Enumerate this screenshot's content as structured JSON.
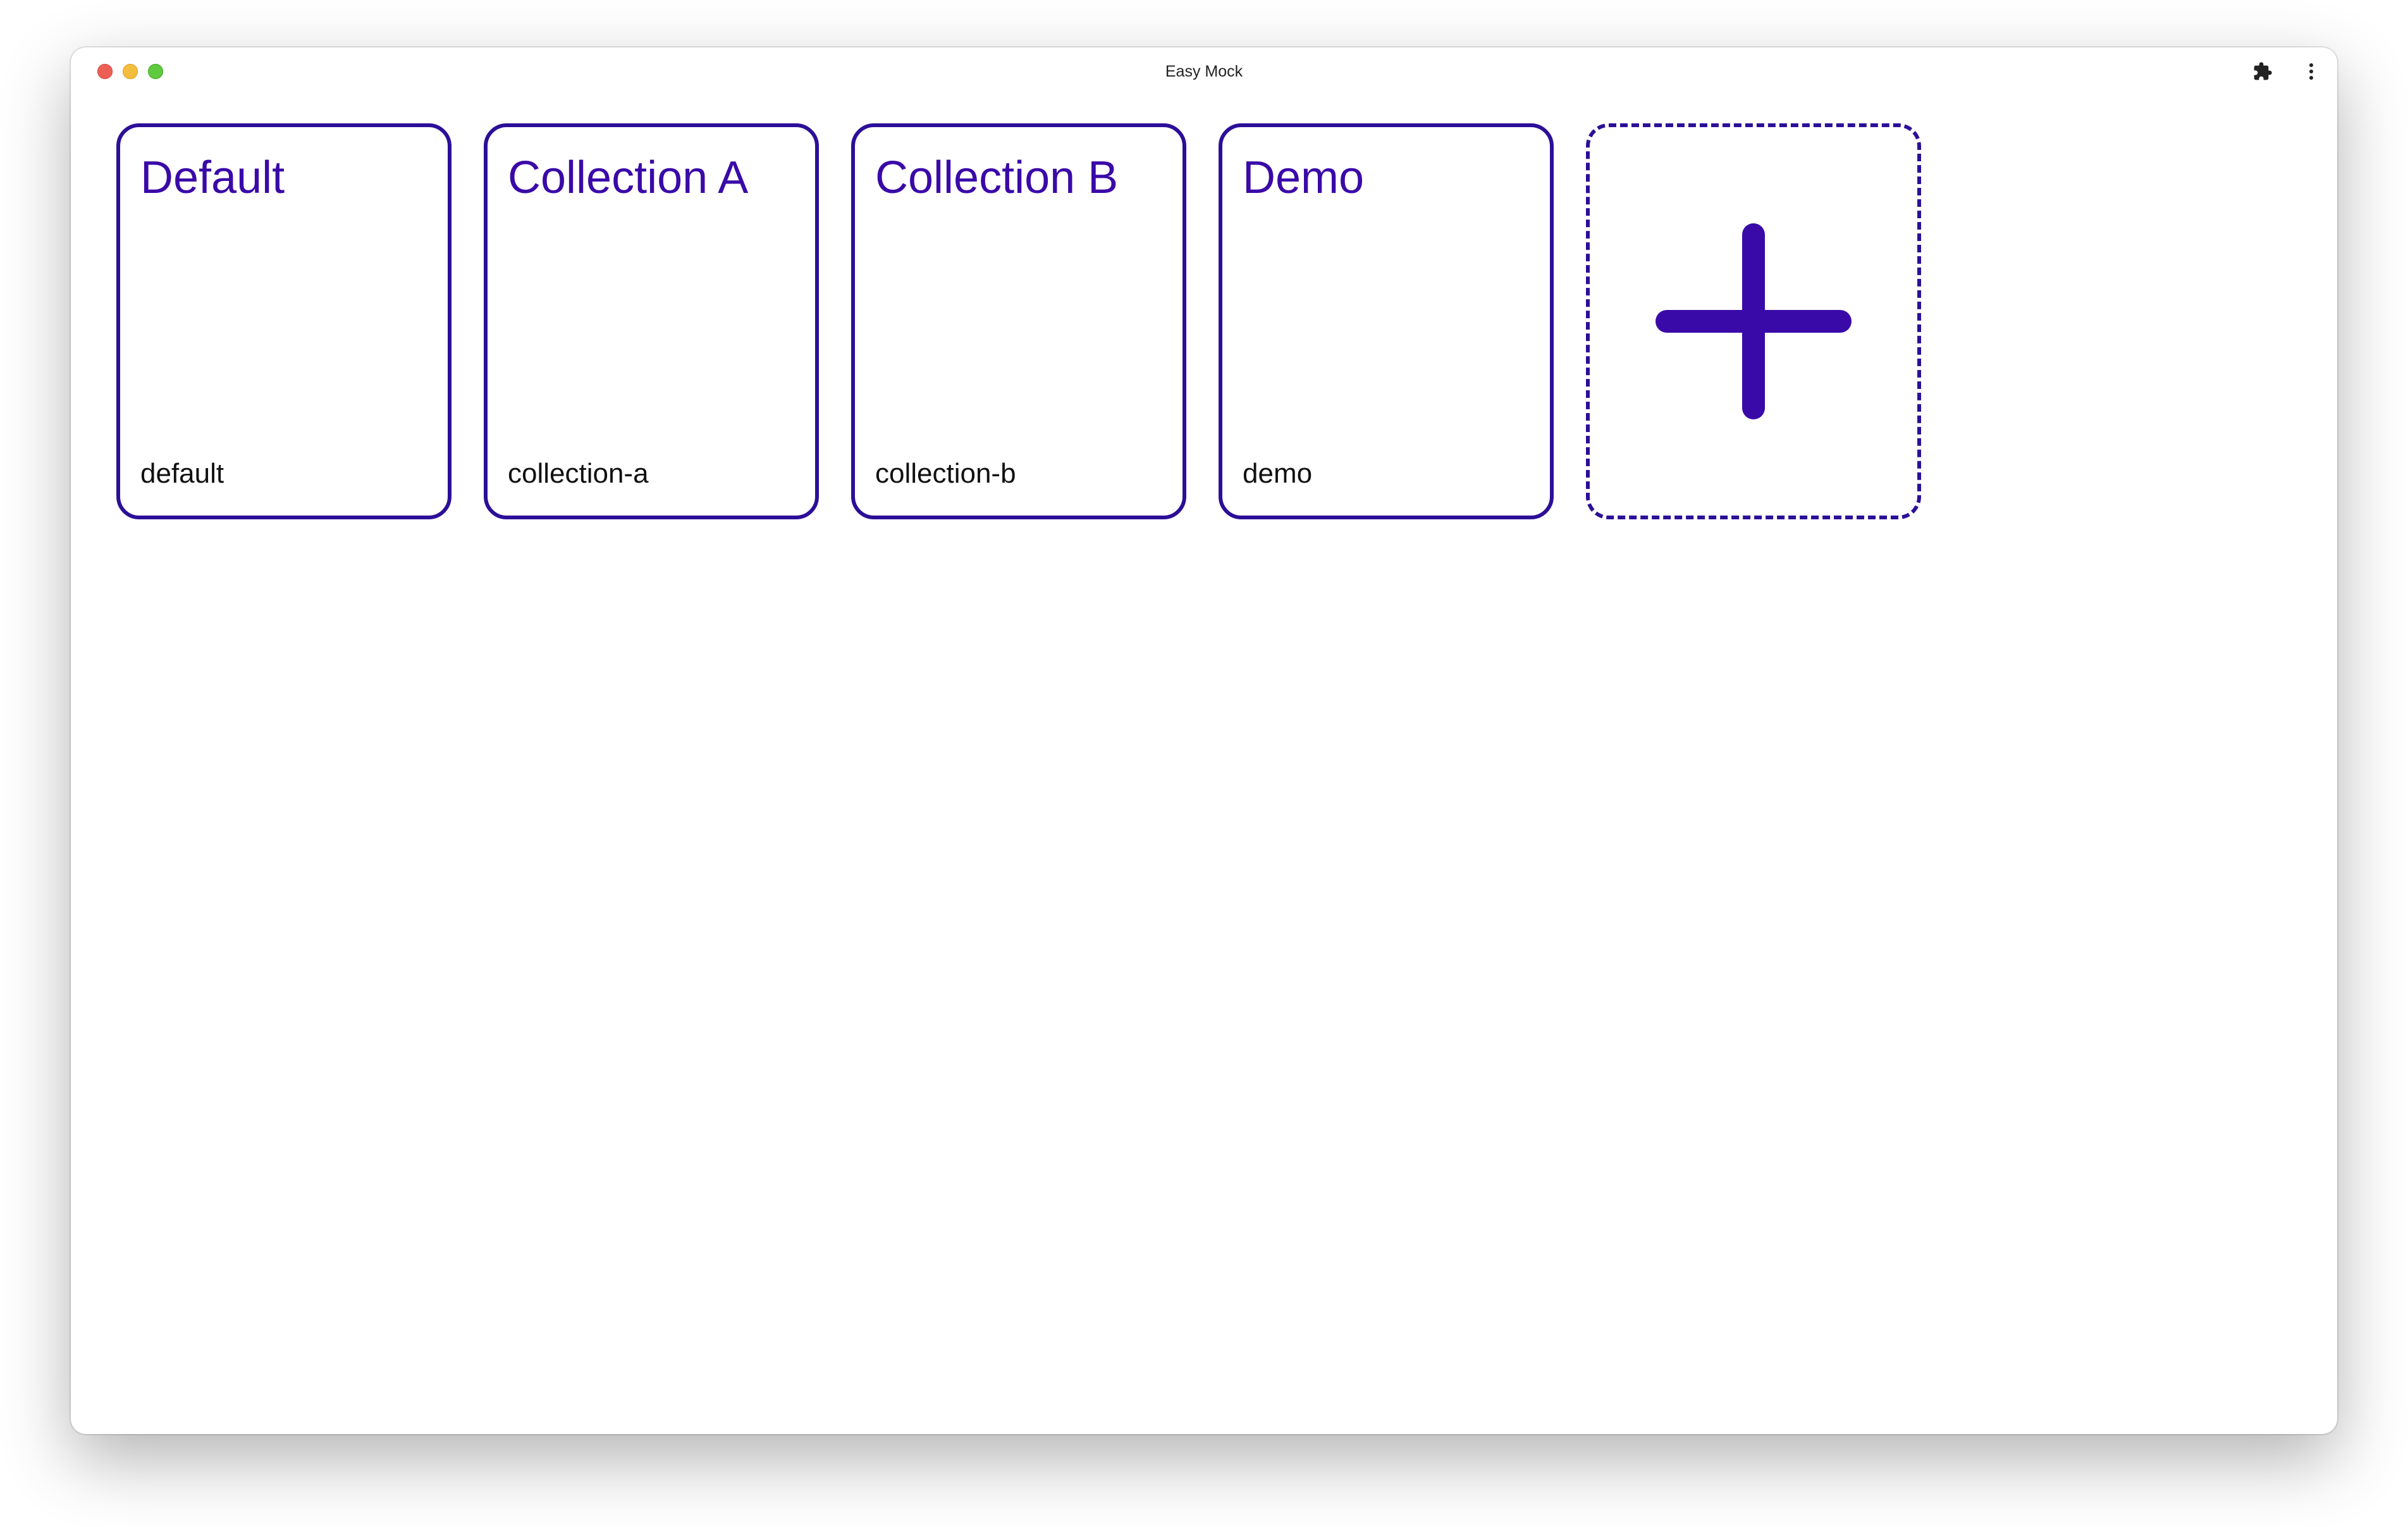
{
  "window": {
    "title": "Easy Mock"
  },
  "titlebar": {
    "traffic_lights": [
      {
        "name": "close",
        "color": "#ed5f55"
      },
      {
        "name": "minimize",
        "color": "#f5bd3d"
      },
      {
        "name": "maximize",
        "color": "#5fc93f"
      }
    ],
    "icons": [
      "puzzle-icon",
      "more-vertical-icon"
    ]
  },
  "collections": [
    {
      "title": "Default",
      "slug": "default"
    },
    {
      "title": "Collection A",
      "slug": "collection-a"
    },
    {
      "title": "Collection B",
      "slug": "collection-b"
    },
    {
      "title": "Demo",
      "slug": "demo"
    }
  ],
  "add_card": {
    "icon": "plus-icon"
  },
  "colors": {
    "accent": "#3a0aa8",
    "border": "#2c0f98",
    "text": "#111111",
    "background": "#ffffff"
  }
}
